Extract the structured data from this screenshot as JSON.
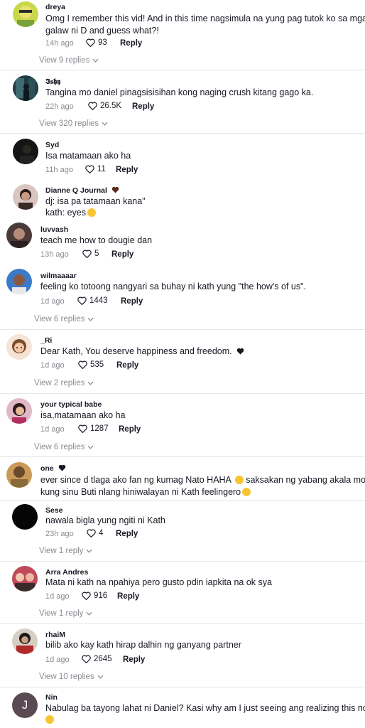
{
  "comments": [
    {
      "name": "dreya",
      "lines": [
        "Omg I remember this vid! And in this time nagsimula na yung pag tutok ko sa mga",
        "galaw ni D and guess what?!"
      ],
      "time": "14h ago",
      "likes": "93",
      "reply": "Reply",
      "view_replies": "View 9 replies"
    },
    {
      "name": "𝕴𝖘𝖍𝖞",
      "lines": [
        "Tangina mo daniel pinagsisisihan kong naging crush kitang gago ka."
      ],
      "time": "22h ago",
      "likes": "26.5K",
      "reply": "Reply",
      "view_replies": "View 320 replies"
    },
    {
      "name": "Syd",
      "lines": [
        "Isa matamaan ako ha"
      ],
      "time": "11h ago",
      "likes": "11",
      "reply": "Reply"
    },
    {
      "name": "Dianne Q Journal",
      "lines": [
        "dj: isa pa tatamaan kana\"",
        "kath: eyes"
      ]
    },
    {
      "name": "luvvash",
      "lines": [
        "teach me how to dougie dan"
      ],
      "time": "13h ago",
      "likes": "5",
      "reply": "Reply"
    },
    {
      "name": "wilmaaaar",
      "lines": [
        "feeling ko totoong nangyari sa buhay ni kath yung \"the how's of us\"."
      ],
      "time": "1d ago",
      "likes": "1443",
      "reply": "Reply",
      "view_replies": "View 6 replies"
    },
    {
      "name": "_Ri",
      "lines": [
        "Dear Kath, You deserve happiness and freedom."
      ],
      "time": "1d ago",
      "likes": "535",
      "reply": "Reply",
      "view_replies": "View 2 replies"
    },
    {
      "name": "your typical babe",
      "lines": [
        "isa,matamaan ako ha"
      ],
      "time": "1d ago",
      "likes": "1287",
      "reply": "Reply",
      "view_replies": "View 6 replies"
    },
    {
      "name": "one",
      "lines": [
        "ever since d tlaga ako fan ng kumag Nato HAHA",
        "kung sinu Buti nlang hiniwalayan ni Kath feelingero"
      ],
      "line1_tail": "saksakan ng yabang akala mo"
    },
    {
      "name": "Sese",
      "lines": [
        "nawala bigla yung ngiti ni Kath"
      ],
      "time": "23h ago",
      "likes": "4",
      "reply": "Reply",
      "view_replies": "View 1 reply"
    },
    {
      "name": "Arra Andres",
      "lines": [
        "Mata ni kath na npahiya pero gusto pdin iapkita na ok sya"
      ],
      "time": "1d ago",
      "likes": "916",
      "reply": "Reply",
      "view_replies": "View 1 reply"
    },
    {
      "name": "rhaiM",
      "lines": [
        "bilib ako kay kath hirap dalhin ng ganyang partner"
      ],
      "time": "1d ago",
      "likes": "2645",
      "reply": "Reply",
      "view_replies": "View 10 replies"
    },
    {
      "name": "Nin",
      "avatar_letter": "J",
      "lines": [
        "Nabulag ba tayong lahat ni Daniel? Kasi why am I just seeing ang realizing this now?"
      ]
    }
  ],
  "colors": {
    "text": "#161823",
    "muted": "#8a8b91",
    "emoji": "#f7c531",
    "heart": "#5a2a1a"
  }
}
